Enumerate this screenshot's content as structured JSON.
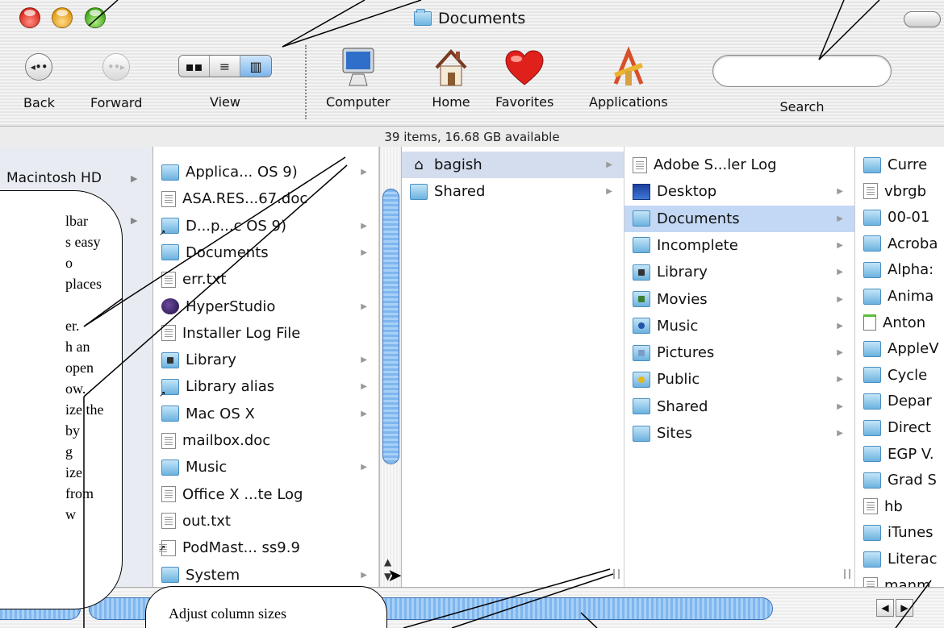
{
  "window": {
    "title": "Documents"
  },
  "toolbar": {
    "back_label": "Back",
    "forward_label": "Forward",
    "view_label": "View",
    "computer_label": "Computer",
    "home_label": "Home",
    "favorites_label": "Favorites",
    "applications_label": "Applications",
    "search_label": "Search",
    "search_value": ""
  },
  "status": {
    "text": "39 items, 16.68 GB available"
  },
  "sidebar": {
    "items": [
      {
        "label": "Macintosh HD"
      },
      {
        "label": ""
      }
    ]
  },
  "column1": {
    "items": [
      {
        "label": "Applica... OS 9)",
        "icon": "folder-icon",
        "arrow": true
      },
      {
        "label": "ASA.RES...67.doc",
        "icon": "document-icon",
        "arrow": false
      },
      {
        "label": "D...p...c OS 9)",
        "icon": "folder-alias-icon",
        "arrow": true
      },
      {
        "label": "Documents",
        "icon": "folder-icon",
        "arrow": true
      },
      {
        "label": "err.txt",
        "icon": "text-file-icon",
        "arrow": false
      },
      {
        "label": "HyperStudio",
        "icon": "hyperstudio-icon",
        "arrow": true
      },
      {
        "label": "Installer Log File",
        "icon": "text-file-icon",
        "arrow": false
      },
      {
        "label": "Library",
        "icon": "library-folder-icon",
        "arrow": true
      },
      {
        "label": "Library alias",
        "icon": "folder-alias-icon",
        "arrow": true
      },
      {
        "label": "Mac OS X",
        "icon": "folder-icon",
        "arrow": true
      },
      {
        "label": "mailbox.doc",
        "icon": "document-icon",
        "arrow": false
      },
      {
        "label": "Music",
        "icon": "folder-icon",
        "arrow": true
      },
      {
        "label": "Office X ...te Log",
        "icon": "text-file-icon",
        "arrow": false
      },
      {
        "label": "out.txt",
        "icon": "text-file-icon",
        "arrow": false
      },
      {
        "label": "PodMast... ss9.9",
        "icon": "alias-file-icon",
        "arrow": false
      },
      {
        "label": "System",
        "icon": "folder-icon",
        "arrow": true
      }
    ]
  },
  "column2": {
    "items": [
      {
        "label": "bagish",
        "icon": "home-icon",
        "arrow": true
      },
      {
        "label": "Shared",
        "icon": "folder-icon",
        "arrow": true
      }
    ]
  },
  "column3": {
    "items": [
      {
        "label": "Adobe S...ler Log",
        "icon": "text-file-icon",
        "arrow": false
      },
      {
        "label": "Desktop",
        "icon": "desktop-folder-icon",
        "arrow": true
      },
      {
        "label": "Documents",
        "icon": "folder-icon",
        "arrow": true
      },
      {
        "label": "Incomplete",
        "icon": "folder-icon",
        "arrow": true
      },
      {
        "label": "Library",
        "icon": "library-folder-icon",
        "arrow": true
      },
      {
        "label": "Movies",
        "icon": "movies-folder-icon",
        "arrow": true
      },
      {
        "label": "Music",
        "icon": "music-folder-icon",
        "arrow": true
      },
      {
        "label": "Pictures",
        "icon": "pictures-folder-icon",
        "arrow": true
      },
      {
        "label": "Public",
        "icon": "public-folder-icon",
        "arrow": true
      },
      {
        "label": "Shared",
        "icon": "folder-icon",
        "arrow": true
      },
      {
        "label": "Sites",
        "icon": "sites-folder-icon",
        "arrow": true
      }
    ]
  },
  "column4": {
    "items": [
      {
        "label": "Curre",
        "icon": "folder-icon"
      },
      {
        "label": "vbrgb",
        "icon": "blank-file-icon"
      },
      {
        "label": "00-01",
        "icon": "folder-icon"
      },
      {
        "label": "Acroba",
        "icon": "folder-icon"
      },
      {
        "label": "Alpha:",
        "icon": "folder-icon"
      },
      {
        "label": "Anima",
        "icon": "folder-icon"
      },
      {
        "label": "Anton",
        "icon": "green-file-icon"
      },
      {
        "label": "AppleV",
        "icon": "folder-icon"
      },
      {
        "label": "Cycle",
        "icon": "folder-icon"
      },
      {
        "label": "Depar",
        "icon": "folder-icon"
      },
      {
        "label": "Direct",
        "icon": "folder-icon"
      },
      {
        "label": "EGP V.",
        "icon": "folder-icon"
      },
      {
        "label": "Grad S",
        "icon": "folder-icon"
      },
      {
        "label": "hb",
        "icon": "blank-file-icon"
      },
      {
        "label": "iTunes",
        "icon": "folder-icon"
      },
      {
        "label": "Literac",
        "icon": "folder-icon"
      },
      {
        "label": "manm",
        "icon": "blank-file-icon"
      }
    ]
  },
  "callouts": {
    "left_lines": [
      "lbar",
      "s easy",
      "o",
      "places",
      "",
      "er.",
      "h an",
      "open",
      "ow.",
      "ize the",
      "by",
      "g",
      "ize",
      "from",
      "w"
    ],
    "bottom": "Adjust column sizes"
  },
  "colors": {
    "selection_gray": "#d4dded",
    "selection_blue": "#c3d8f5",
    "scroll_thumb": "#7fb6ee"
  }
}
